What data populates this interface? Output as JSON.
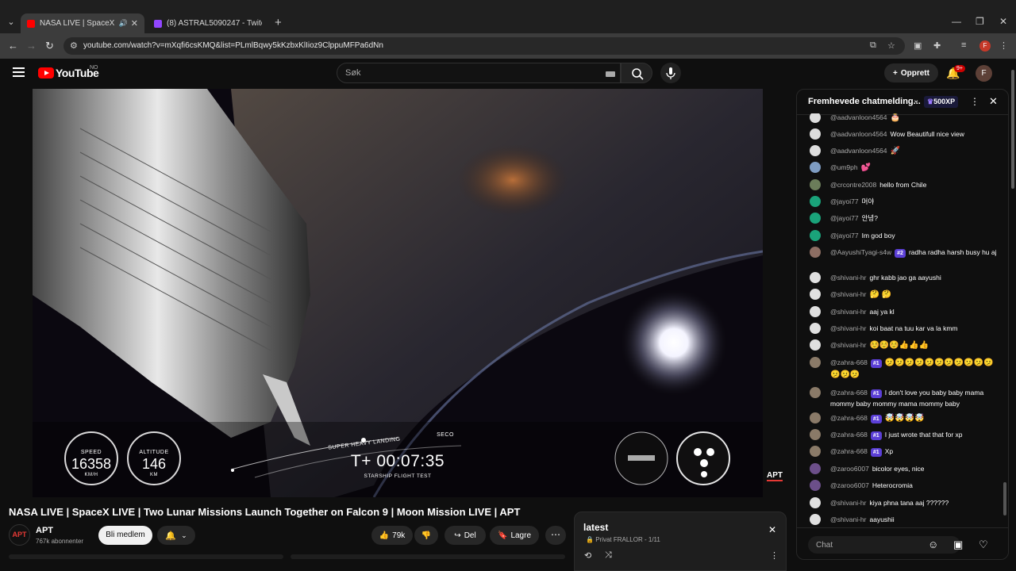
{
  "browser": {
    "tabs": [
      {
        "title": "NASA LIVE | SpaceX LIVE | T",
        "active": true
      },
      {
        "title": "(8) ASTRAL5090247 - Twitch",
        "active": false
      }
    ],
    "url": "youtube.com/watch?v=mXqfi6csKMQ&list=PLmlBqwy5kKzbxKlIioz9ClppuMFPa6dNn",
    "profile_initial": "F"
  },
  "yt": {
    "logo_text": "YouTube",
    "country": "NO",
    "search_placeholder": "Søk",
    "create_label": "Opprett",
    "notif_count": "9+",
    "avatar_initial": "F"
  },
  "video": {
    "title": "NASA LIVE | SpaceX LIVE | Two Lunar Missions Launch Together on Falcon 9 | Moon Mission LIVE | APT",
    "hud": {
      "speed_label": "SPEED",
      "speed_value": "16358",
      "speed_unit": "KM/H",
      "altitude_label": "ALTITUDE",
      "altitude_value": "146",
      "altitude_unit": "KM",
      "timeline_event_1": "SUPER HEAVY LANDING",
      "timeline_event_2": "SECO",
      "clock": "T+ 00:07:35",
      "mission": "STARSHIP FLIGHT TEST"
    },
    "watermark": "APT"
  },
  "channel": {
    "name": "APT",
    "avatar_text": "APT",
    "subscribers": "767k abonnenter",
    "join_label": "Bli medlem"
  },
  "actions": {
    "likes": "79k",
    "share_label": "Del",
    "save_label": "Lagre"
  },
  "playlist": {
    "title": "latest",
    "meta": "Privat  FRALLOR - 1/11"
  },
  "chat": {
    "header_title": "Fremhevede chatmelding...",
    "xp_badge": "500XP",
    "input_placeholder": "Chat",
    "messages": [
      {
        "author": "@aadvanloon4564",
        "text": "",
        "emoji": "🎂",
        "avatar_color": "#dddddd",
        "rank": ""
      },
      {
        "author": "@aadvanloon4564",
        "text": "Wow Beautifull nice view",
        "emoji": "",
        "avatar_color": "#dddddd",
        "rank": ""
      },
      {
        "author": "@aadvanloon4564",
        "text": "",
        "emoji": "🚀",
        "avatar_color": "#dddddd",
        "rank": ""
      },
      {
        "author": "@um9ph",
        "text": "",
        "emoji": "💕",
        "avatar_color": "#7e9cc2",
        "rank": ""
      },
      {
        "author": "@crcontre2008",
        "text": "hello from Chile",
        "emoji": "",
        "avatar_color": "#6b7d5a",
        "rank": ""
      },
      {
        "author": "@jayoi77",
        "text": "머야",
        "emoji": "",
        "avatar_color": "#1aa37a",
        "rank": ""
      },
      {
        "author": "@jayoi77",
        "text": "안녕?",
        "emoji": "",
        "avatar_color": "#1aa37a",
        "rank": ""
      },
      {
        "author": "@jayoi77",
        "text": "Im god boy",
        "emoji": "",
        "avatar_color": "#1aa37a",
        "rank": ""
      },
      {
        "author": "@AayushiTyagi-s4w",
        "text": "radha radha harsh busy hu aj",
        "emoji": "",
        "avatar_color": "#8d6e63",
        "rank": "#2"
      },
      {
        "author": "@shivani-hr",
        "text": "ghr kabb jao ga aayushi",
        "emoji": "",
        "avatar_color": "#e0e0e0",
        "rank": ""
      },
      {
        "author": "@shivani-hr",
        "text": "",
        "emoji": "🤔 🤔",
        "avatar_color": "#e0e0e0",
        "rank": ""
      },
      {
        "author": "@shivani-hr",
        "text": "aaj ya kl",
        "emoji": "",
        "avatar_color": "#e0e0e0",
        "rank": ""
      },
      {
        "author": "@shivani-hr",
        "text": "koi baat na tuu kar va la kmm",
        "emoji": "",
        "avatar_color": "#e0e0e0",
        "rank": ""
      },
      {
        "author": "@shivani-hr",
        "text": "",
        "emoji": "☺️☺️☺️👍👍👍",
        "avatar_color": "#e0e0e0",
        "rank": ""
      },
      {
        "author": "@zahra-668",
        "text": "",
        "emoji": "🫤🫤🫤🫤🫤🫤🫤🫤🫤🫤🫤🫤🫤🫤",
        "avatar_color": "#8a7a68",
        "rank": "#1"
      },
      {
        "author": "@zahra-668",
        "text": "I don't love you baby baby mama mommy baby mommy mama mommy baby",
        "emoji": "",
        "avatar_color": "#8a7a68",
        "rank": "#1"
      },
      {
        "author": "@zahra-668",
        "text": "",
        "emoji": "🤯🤯🤯🤯",
        "avatar_color": "#8a7a68",
        "rank": "#1"
      },
      {
        "author": "@zahra-668",
        "text": "I just wrote that that for xp",
        "emoji": "",
        "avatar_color": "#8a7a68",
        "rank": "#1"
      },
      {
        "author": "@zahra-668",
        "text": "Xp",
        "emoji": "",
        "avatar_color": "#8a7a68",
        "rank": "#1"
      },
      {
        "author": "@zaroo6007",
        "text": "bicolor eyes, nice",
        "emoji": "",
        "avatar_color": "#6c4f8a",
        "rank": ""
      },
      {
        "author": "@zaroo6007",
        "text": "Heterocromia",
        "emoji": "",
        "avatar_color": "#6c4f8a",
        "rank": ""
      },
      {
        "author": "@shivani-hr",
        "text": "kiya phna tana aaj ??????",
        "emoji": "",
        "avatar_color": "#e0e0e0",
        "rank": ""
      },
      {
        "author": "@shivani-hr",
        "text": "aayushii",
        "emoji": "",
        "avatar_color": "#e0e0e0",
        "rank": ""
      }
    ]
  }
}
